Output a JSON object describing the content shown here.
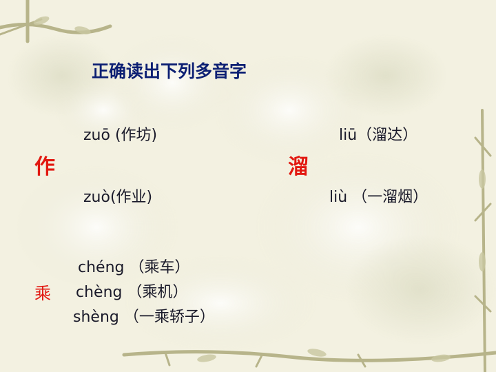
{
  "slide": {
    "title": "正确读出下列多音字",
    "groups": [
      {
        "character": "作",
        "readings": [
          {
            "pinyin": "zuō",
            "gloss": "(作坊)"
          },
          {
            "pinyin": "zuò",
            "gloss": "(作业)"
          }
        ]
      },
      {
        "character": "溜",
        "readings": [
          {
            "pinyin": "liū",
            "gloss": "（溜达）"
          },
          {
            "pinyin": "liù",
            "gloss": "（一溜烟）"
          }
        ]
      },
      {
        "character": "乘",
        "readings": [
          {
            "pinyin": "chéng",
            "gloss": "（乘车）"
          },
          {
            "pinyin": "chèng",
            "gloss": "（乘机）"
          },
          {
            "pinyin": "shèng",
            "gloss": "（一乘轿子）"
          }
        ]
      }
    ]
  },
  "colors": {
    "title": "#0c1f73",
    "character": "#e21810",
    "text": "#1a1a2a",
    "background": "#f4f1e2"
  }
}
